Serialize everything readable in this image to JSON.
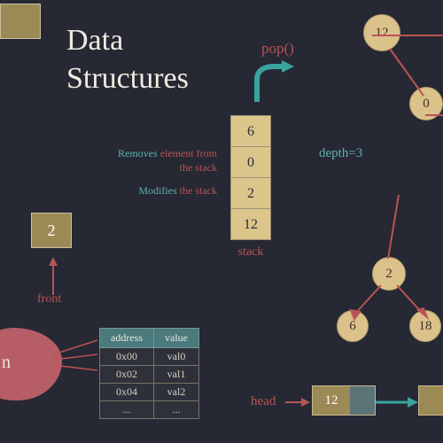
{
  "title_line1": "Data",
  "title_line2": "Structures",
  "stack": {
    "pop_label": "pop()",
    "cells": [
      "6",
      "0",
      "2",
      "12"
    ],
    "label": "stack",
    "desc1_a": "Removes",
    "desc1_b": "element from the stack",
    "desc2_a": "Modifies",
    "desc2_b": "the stack"
  },
  "queue_value": "2",
  "front_label": "front",
  "blob_text": "n",
  "table": {
    "headers": [
      "address",
      "value"
    ],
    "rows": [
      [
        "0x00",
        "val0"
      ],
      [
        "0x02",
        "val1"
      ],
      [
        "0x04",
        "val2"
      ],
      [
        "...",
        "..."
      ]
    ]
  },
  "tree": {
    "depth_label": "depth=3",
    "root": "12",
    "right": "0",
    "sub_root": "2",
    "sub_left": "6",
    "sub_right": "18"
  },
  "linked_list": {
    "head_label": "head",
    "first_value": "12"
  },
  "colors": {
    "teal_arrow": "#3aa3a0",
    "red": "#b95454"
  }
}
